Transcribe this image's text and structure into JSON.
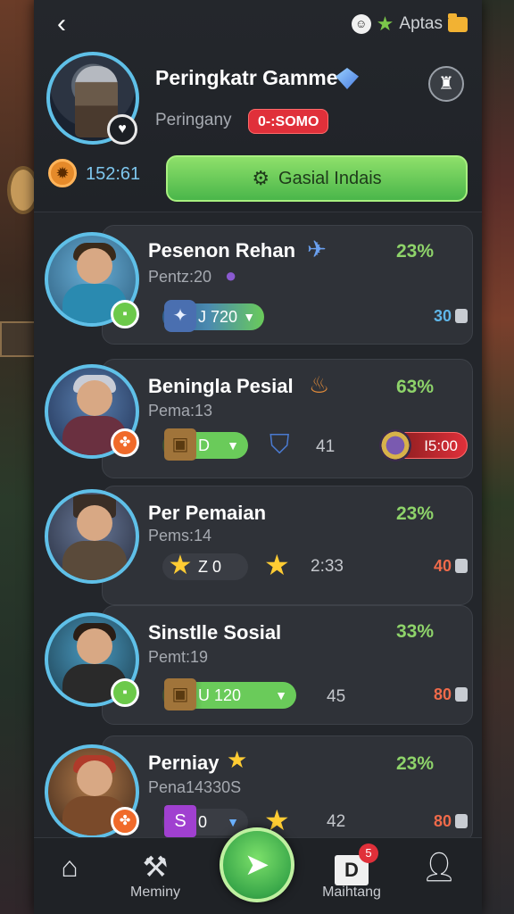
{
  "header": {
    "top_right_label": "Aptas",
    "title": "Peringkatr Gamme",
    "subtitle": "Peringany",
    "code_badge": "0-:SOMO",
    "stat_value": "152:61",
    "cta_label": "Gasial Indais"
  },
  "rows": [
    {
      "name": "Pesenon Rehan",
      "sub": "Pentz:20",
      "percent": "23%",
      "pill_value": "J  720",
      "right_value": "30",
      "right_color": "#5fb6e8"
    },
    {
      "name": "Beningla Pesial",
      "sub": "Pema:13",
      "percent": "63%",
      "pill_value": "D",
      "mid_value": "41",
      "red_pill_value": "I5:00"
    },
    {
      "name": "Per Pemaian",
      "sub": "Pems:14",
      "percent": "23%",
      "pill_value": "Z  0",
      "mid_value": "2:33",
      "right_value": "40",
      "right_color": "#f06a4a"
    },
    {
      "name": "Sinstlle Sosial",
      "sub": "Pemt:19",
      "percent": "33%",
      "pill_value": "U  120",
      "mid_value": "45",
      "right_value": "80",
      "right_color": "#f06a4a"
    },
    {
      "name": "Perniay",
      "sub": "Pena14330S",
      "percent": "23%",
      "pill_value": "0",
      "mid_value": "42",
      "right_value": "80",
      "right_color": "#f06a4a"
    }
  ],
  "nav": {
    "item2_label": "Meminy",
    "item4_label": "Maihtang",
    "notif_count": "5",
    "d_letter": "D"
  },
  "colors": {
    "accent_green": "#6acb5a",
    "accent_red": "#e0303a",
    "accent_blue": "#5fc0e8"
  }
}
